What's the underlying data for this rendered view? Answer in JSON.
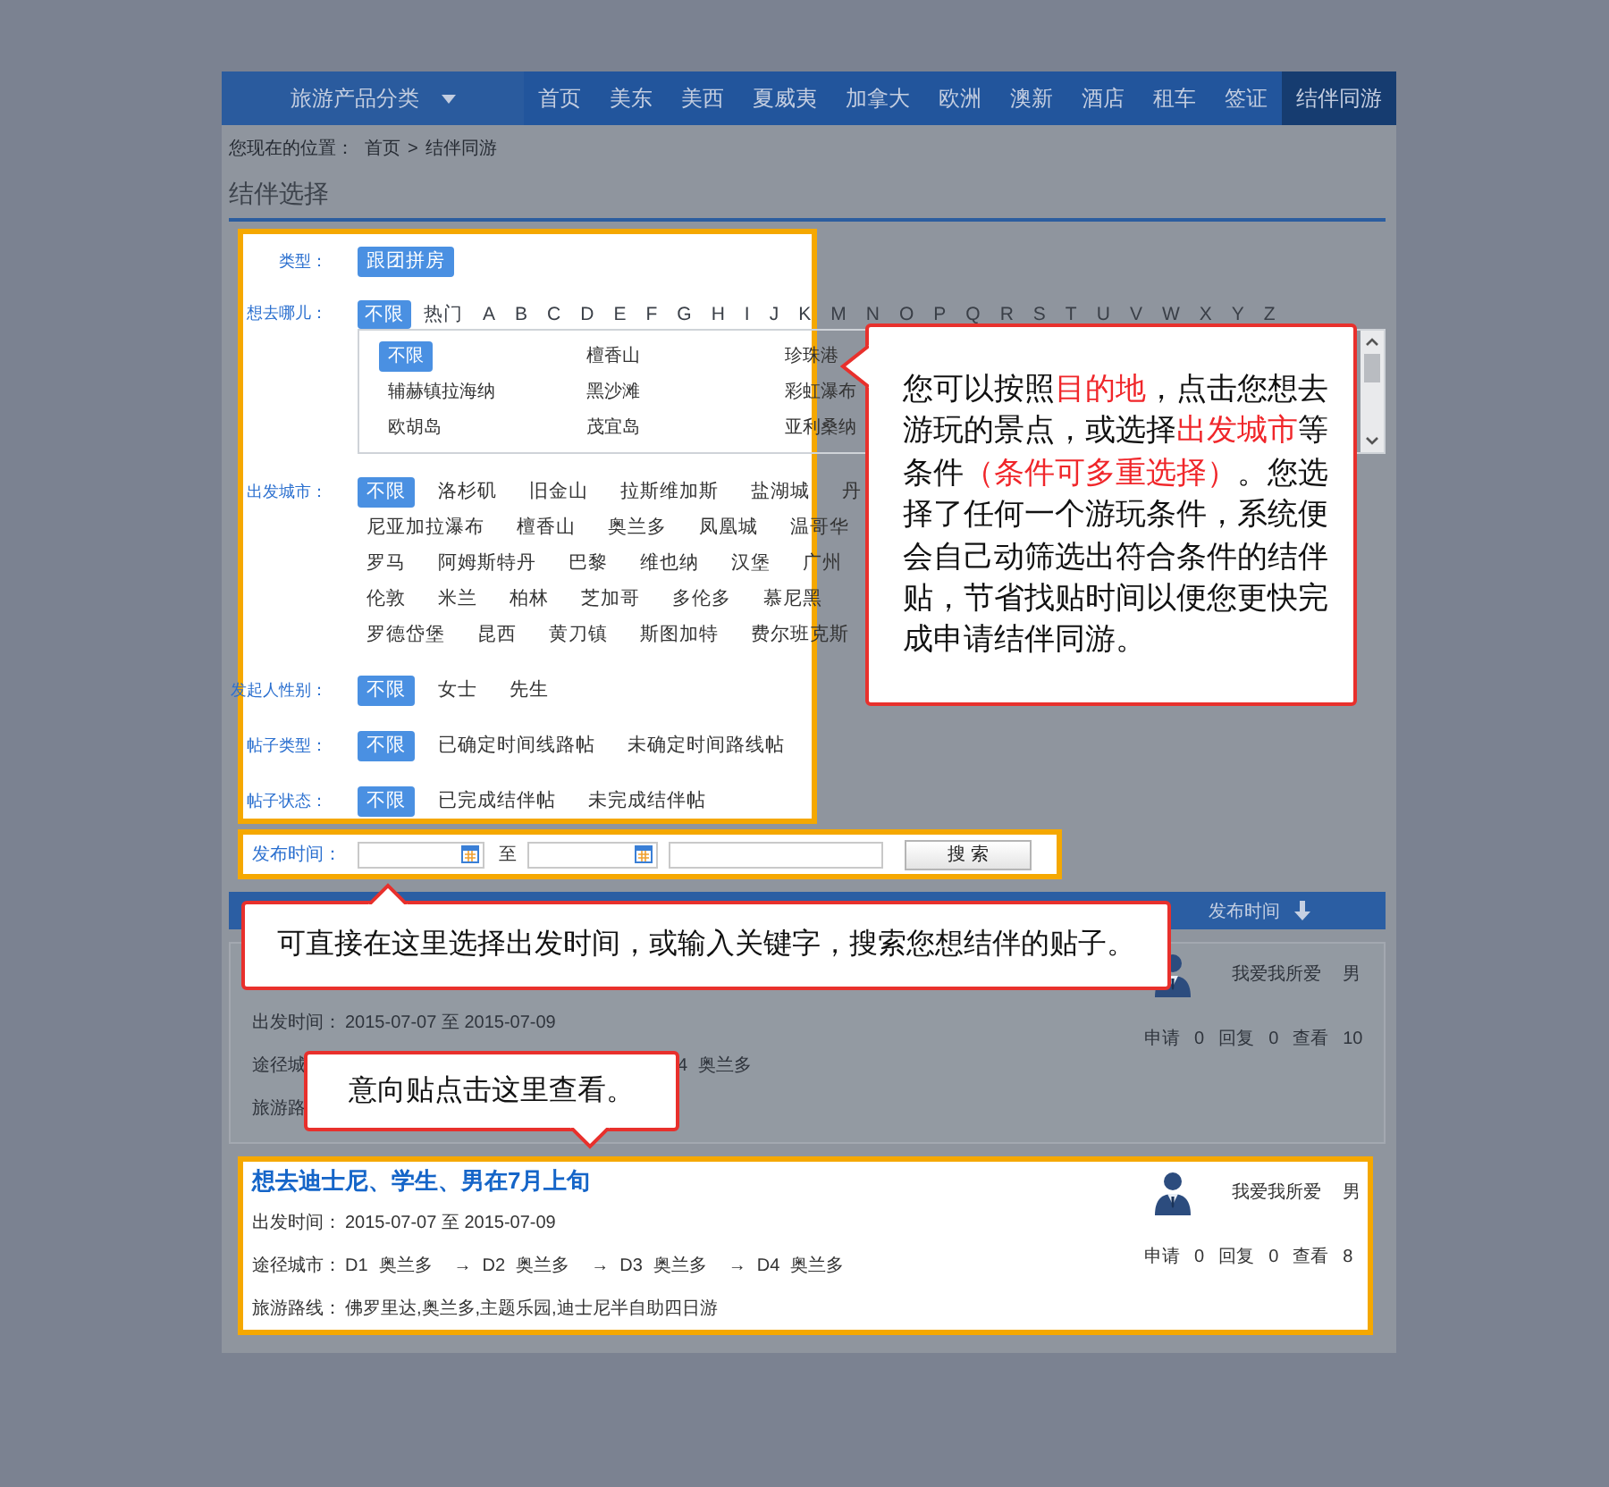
{
  "nav": {
    "category": {
      "label": "旅游产品分类"
    },
    "items": [
      {
        "label": "首页",
        "selected": false
      },
      {
        "label": "美东",
        "selected": false
      },
      {
        "label": "美西",
        "selected": false
      },
      {
        "label": "夏威夷",
        "selected": false
      },
      {
        "label": "加拿大",
        "selected": false
      },
      {
        "label": "欧洲",
        "selected": false
      },
      {
        "label": "澳新",
        "selected": false
      },
      {
        "label": "酒店",
        "selected": false
      },
      {
        "label": "租车",
        "selected": false
      },
      {
        "label": "签证",
        "selected": false
      },
      {
        "label": "结伴同游",
        "selected": true
      }
    ]
  },
  "breadcrumb": {
    "prefix": "您现在的位置：",
    "link": "首页",
    "separator": ">",
    "current": "结伴同游"
  },
  "section_title": "结伴选择",
  "filters": {
    "highlighted": true,
    "type": {
      "label": "类型：",
      "options": [
        {
          "label": "跟团拼房",
          "selected": true
        }
      ]
    },
    "destination": {
      "label": "想去哪儿：",
      "index": [
        {
          "label": "不限",
          "selected": true
        },
        {
          "label": "热门",
          "selected": false
        },
        {
          "label": "A",
          "selected": false
        },
        {
          "label": "B",
          "selected": false
        },
        {
          "label": "C",
          "selected": false
        },
        {
          "label": "D",
          "selected": false
        },
        {
          "label": "E",
          "selected": false
        },
        {
          "label": "F",
          "selected": false
        },
        {
          "label": "G",
          "selected": false
        },
        {
          "label": "H",
          "selected": false
        },
        {
          "label": "I",
          "selected": false
        },
        {
          "label": "J",
          "selected": false
        },
        {
          "label": "K",
          "selected": false
        },
        {
          "label": "M",
          "selected": false
        },
        {
          "label": "N",
          "selected": false
        },
        {
          "label": "O",
          "selected": false
        },
        {
          "label": "P",
          "selected": false
        },
        {
          "label": "Q",
          "selected": false
        },
        {
          "label": "R",
          "selected": false
        },
        {
          "label": "S",
          "selected": false
        },
        {
          "label": "T",
          "selected": false
        },
        {
          "label": "U",
          "selected": false
        },
        {
          "label": "V",
          "selected": false
        },
        {
          "label": "W",
          "selected": false
        },
        {
          "label": "X",
          "selected": false
        },
        {
          "label": "Y",
          "selected": false
        },
        {
          "label": "Z",
          "selected": false
        }
      ],
      "places": [
        [
          {
            "label": "不限",
            "selected": true
          },
          {
            "label": "檀香山",
            "selected": false
          },
          {
            "label": "珍珠港",
            "selected": false
          }
        ],
        [
          {
            "label": "辅赫镇拉海纳",
            "selected": false
          },
          {
            "label": "黑沙滩",
            "selected": false
          },
          {
            "label": "彩虹瀑布",
            "selected": false
          }
        ],
        [
          {
            "label": "欧胡岛",
            "selected": false
          },
          {
            "label": "茂宜岛",
            "selected": false
          },
          {
            "label": "亚利桑纳",
            "selected": false
          }
        ]
      ]
    },
    "departure": {
      "label": "出发城市：",
      "rows": [
        [
          {
            "label": "不限",
            "selected": true
          },
          {
            "label": "洛杉矶",
            "selected": false
          },
          {
            "label": "旧金山",
            "selected": false
          },
          {
            "label": "拉斯维加斯",
            "selected": false
          },
          {
            "label": "盐湖城",
            "selected": false
          },
          {
            "label": "丹",
            "selected": false
          }
        ],
        [
          {
            "label": "尼亚加拉瀑布",
            "selected": false
          },
          {
            "label": "檀香山",
            "selected": false
          },
          {
            "label": "奥兰多",
            "selected": false
          },
          {
            "label": "凤凰城",
            "selected": false
          },
          {
            "label": "温哥华",
            "selected": false
          }
        ],
        [
          {
            "label": "罗马",
            "selected": false
          },
          {
            "label": "阿姆斯特丹",
            "selected": false
          },
          {
            "label": "巴黎",
            "selected": false
          },
          {
            "label": "维也纳",
            "selected": false
          },
          {
            "label": "汉堡",
            "selected": false
          },
          {
            "label": "广州",
            "selected": false
          }
        ],
        [
          {
            "label": "伦敦",
            "selected": false
          },
          {
            "label": "米兰",
            "selected": false
          },
          {
            "label": "柏林",
            "selected": false
          },
          {
            "label": "芝加哥",
            "selected": false
          },
          {
            "label": "多伦多",
            "selected": false
          },
          {
            "label": "慕尼黑",
            "selected": false
          }
        ],
        [
          {
            "label": "罗德岱堡",
            "selected": false
          },
          {
            "label": "昆西",
            "selected": false
          },
          {
            "label": "黄刀镇",
            "selected": false
          },
          {
            "label": "斯图加特",
            "selected": false
          },
          {
            "label": "费尔班克斯",
            "selected": false
          }
        ]
      ]
    },
    "gender": {
      "label": "发起人性别：",
      "options": [
        {
          "label": "不限",
          "selected": true
        },
        {
          "label": "女士",
          "selected": false
        },
        {
          "label": "先生",
          "selected": false
        }
      ]
    },
    "post_type": {
      "label": "帖子类型：",
      "options": [
        {
          "label": "不限",
          "selected": true
        },
        {
          "label": "已确定时间线路帖",
          "selected": false
        },
        {
          "label": "未确定时间路线帖",
          "selected": false
        }
      ]
    },
    "status": {
      "label": "帖子状态：",
      "options": [
        {
          "label": "不限",
          "selected": true
        },
        {
          "label": "已完成结伴帖",
          "selected": false
        },
        {
          "label": "未完成结伴帖",
          "selected": false
        }
      ]
    }
  },
  "search": {
    "highlighted": true,
    "label": "发布时间：",
    "range_separator": "至",
    "button": "搜 索"
  },
  "list_header": {
    "sort_label": "发布时间"
  },
  "posts": [
    {
      "kind": "covered",
      "highlighted": false,
      "author": "我爱我所爱",
      "gender": "男",
      "dates_label": "出发时间：",
      "dates": "2015-07-07 至 2015-07-09",
      "route_label": "途径城",
      "route": [
        {
          "day": "4",
          "city": "奥兰多"
        }
      ],
      "line_label": "旅游路",
      "stats": [
        {
          "label": "申请",
          "value": "0"
        },
        {
          "label": "回复",
          "value": "0"
        },
        {
          "label": "查看",
          "value": "10"
        }
      ]
    },
    {
      "kind": "full",
      "highlighted": true,
      "title": "想去迪士尼、学生、男在7月上旬",
      "author": "我爱我所爱",
      "gender": "男",
      "dates_label": "出发时间：",
      "dates": "2015-07-07 至 2015-07-09",
      "route_label": "途径城市：",
      "route": [
        {
          "day": "D1",
          "city": "奥兰多"
        },
        {
          "arrow": "→",
          "day": "D2",
          "city": "奥兰多"
        },
        {
          "arrow": "→",
          "day": "D3",
          "city": "奥兰多"
        },
        {
          "arrow": "→",
          "day": "D4",
          "city": "奥兰多"
        }
      ],
      "line_label": "旅游路线：",
      "line": "佛罗里达,奥兰多,主题乐园,迪士尼半自助四日游",
      "stats": [
        {
          "label": "申请",
          "value": "0"
        },
        {
          "label": "回复",
          "value": "0"
        },
        {
          "label": "查看",
          "value": "8"
        }
      ]
    }
  ],
  "callouts": [
    {
      "kind": "left",
      "segments": [
        {
          "text": "您可以按照",
          "highlight": false
        },
        {
          "text": "目的地",
          "highlight": true
        },
        {
          "text": "，点击您想去游玩的景点，或选择",
          "highlight": false
        },
        {
          "text": "出发城市",
          "highlight": true
        },
        {
          "text": "等条件",
          "highlight": false
        },
        {
          "text": "（条件可多重选择）",
          "highlight": true
        },
        {
          "text": "。您选择了任何一个游玩条件，系统便会自己动筛选出符合条件的结伴贴，节省找贴时间以便您更快完成申请结伴同游。",
          "highlight": false
        }
      ]
    },
    {
      "kind": "up",
      "segments": [
        {
          "text": "可直接在这里选择出发时间，或输入关键字，搜索您想结伴的贴子。",
          "highlight": false
        }
      ]
    },
    {
      "kind": "down",
      "segments": [
        {
          "text": "意向贴点击这里查看。",
          "highlight": false
        }
      ]
    }
  ]
}
